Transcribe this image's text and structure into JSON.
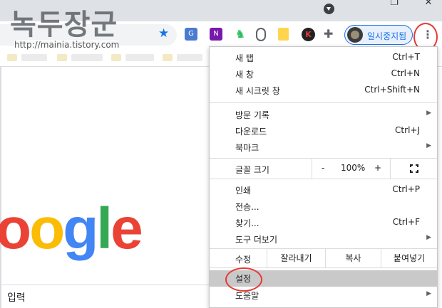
{
  "watermark": {
    "title": "녹두장군",
    "url": "http://mainia.tistory.com"
  },
  "toolbar": {
    "profile_label": "일시중지됨",
    "icons": [
      "star-icon",
      "translate-icon",
      "onenote-icon",
      "evernote-icon",
      "mouse-icon",
      "doc-icon",
      "k-icon",
      "puzzle-icon",
      "kebab-menu-icon"
    ]
  },
  "page": {
    "logo_letters": [
      "o",
      "o",
      "g",
      "l",
      "e"
    ],
    "logo_colors": [
      "#ea4335",
      "#fbbc05",
      "#4285f4",
      "#34a853",
      "#ea4335"
    ],
    "search_text": "입력"
  },
  "menu": {
    "items_top": [
      {
        "label": "새 탭",
        "shortcut": "Ctrl+T"
      },
      {
        "label": "새 창",
        "shortcut": "Ctrl+N"
      },
      {
        "label": "새 시크릿 창",
        "shortcut": "Ctrl+Shift+N"
      }
    ],
    "items_history": [
      {
        "label": "방문 기록",
        "shortcut": ""
      },
      {
        "label": "다운로드",
        "shortcut": "Ctrl+J"
      },
      {
        "label": "북마크",
        "shortcut": ""
      }
    ],
    "zoom": {
      "label": "글꼴 크기",
      "minus": "-",
      "value": "100%",
      "plus": "+"
    },
    "items_tools": [
      {
        "label": "인쇄",
        "shortcut": "Ctrl+P"
      },
      {
        "label": "전송...",
        "shortcut": ""
      },
      {
        "label": "찾기...",
        "shortcut": "Ctrl+F"
      },
      {
        "label": "도구 더보기",
        "shortcut": ""
      }
    ],
    "edit": {
      "label": "수정",
      "cut": "잘라내기",
      "copy": "복사",
      "paste": "붙여넣기"
    },
    "settings": "설정",
    "help": "도움말"
  },
  "colors": {
    "highlight_ring": "#e53935",
    "accent": "#1a73e8"
  }
}
